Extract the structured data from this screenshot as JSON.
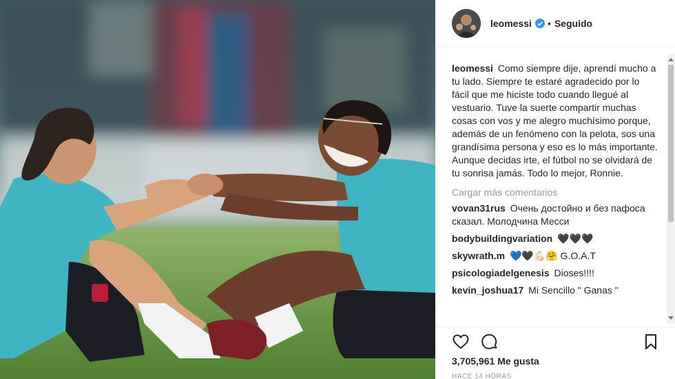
{
  "post": {
    "username": "leomessi",
    "dot": "•",
    "follow_label": "Seguido",
    "caption_user": "leomessi",
    "caption": "Como siempre dije, aprendí mucho a tu lado. Siempre te estaré agradecido por lo fácil que me hiciste todo cuando llegué al vestuario. Tuve la suerte compartir muchas cosas con vos y me alegro muchísimo porque, además de un fenómeno con la pelota, sos una grandísima persona y eso es lo más importante. Aunque decidas irte, el fútbol no se olvidará de tu sonrisa jamás. Todo lo mejor, Ronnie.",
    "load_more": "Cargar más comentarios",
    "likes": "3,705,961 Me gusta",
    "time": "HACE 14 HORAS"
  },
  "comments": [
    {
      "user": "vovan31rus",
      "text": "Очень достойно и без пафоса сказал. Молодчина Месси"
    },
    {
      "user": "bodybuildingvariation",
      "text": "🖤🖤🖤"
    },
    {
      "user": "skywrath.m",
      "text": "💙🖤💪🏻🤗 G.O.A.T"
    },
    {
      "user": "psicologiadelgenesis",
      "text": "Dioses!!!!"
    },
    {
      "user": "kevin_joshua17",
      "text": "Mi Sencillo \" Ganas \""
    }
  ],
  "icons": [
    "verified-icon",
    "heart-icon",
    "comment-icon",
    "bookmark-icon"
  ],
  "colors": {
    "verified": "#3897f0",
    "text": "#262626",
    "muted": "#999999",
    "jersey": "#3fb5c4"
  }
}
